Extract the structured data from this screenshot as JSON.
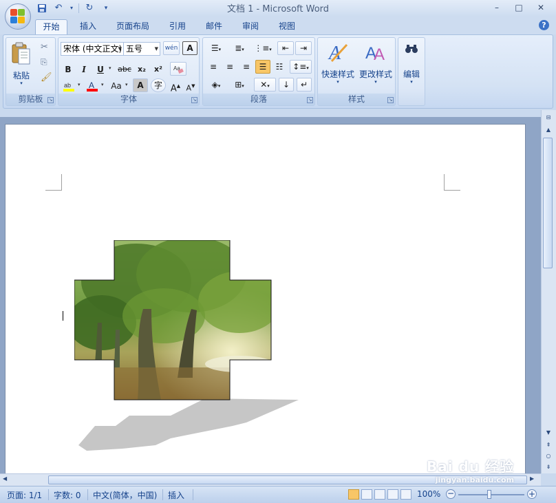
{
  "window": {
    "title": "文档 1 - Microsoft Word",
    "minimize": "–",
    "maximize": "□",
    "close": "✕"
  },
  "tabs": [
    {
      "label": "开始",
      "active": true
    },
    {
      "label": "插入"
    },
    {
      "label": "页面布局"
    },
    {
      "label": "引用"
    },
    {
      "label": "邮件"
    },
    {
      "label": "审阅"
    },
    {
      "label": "视图"
    }
  ],
  "help": "?",
  "clipboard": {
    "group_label": "剪贴板",
    "paste_label": "粘贴"
  },
  "font": {
    "group_label": "字体",
    "font_name": "宋体 (中文正文)",
    "font_size": "五号",
    "bold": "B",
    "italic": "I",
    "underline": "U",
    "strike": "abc",
    "subscript": "x₂",
    "superscript": "x²",
    "grow": "A",
    "shrink": "A",
    "change_case": "Aa",
    "char_shade": "A",
    "enclose": "字",
    "phonetic": "wén",
    "clear_format": "A"
  },
  "paragraph": {
    "group_label": "段落"
  },
  "styles": {
    "group_label": "样式",
    "quick_styles": "快速样式",
    "change_styles": "更改样式"
  },
  "editing": {
    "label": "编辑"
  },
  "statusbar": {
    "page": "页面: 1/1",
    "words": "字数: 0",
    "language": "中文(简体，中国)",
    "mode": "插入",
    "zoom": "100%"
  },
  "watermark": {
    "brand": "Bai du 经验",
    "url": "jingyan.baidu.com"
  },
  "colors": {
    "ribbon_blue": "#15428b",
    "highlight": "#ffff00",
    "font_color": "#ff0000",
    "active_align": "#f8c667"
  }
}
